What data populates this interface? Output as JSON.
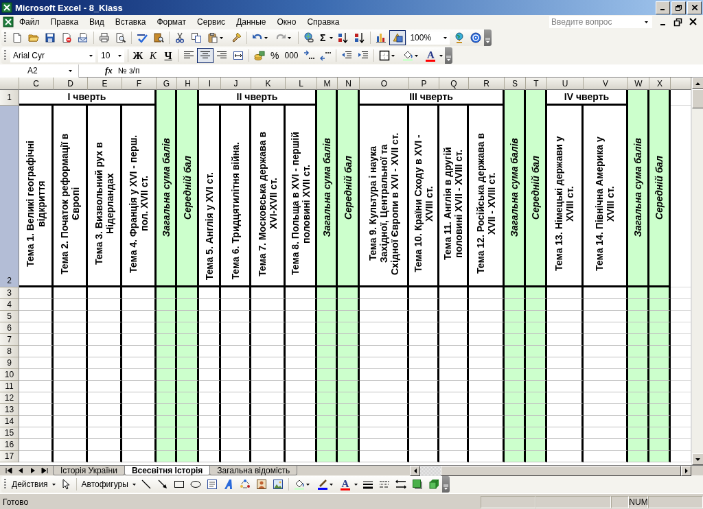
{
  "window": {
    "title": "Microsoft Excel - 8_Klass"
  },
  "menu": [
    "Файл",
    "Правка",
    "Вид",
    "Вставка",
    "Формат",
    "Сервис",
    "Данные",
    "Окно",
    "Справка"
  ],
  "help_box": {
    "placeholder": "Введите вопрос"
  },
  "standard_toolbar": {
    "autosum": "Σ",
    "drawing_toggle": {
      "on": true
    },
    "zoom": "100%"
  },
  "formatting_toolbar": {
    "font": "Arial Cyr",
    "size": "10",
    "style_buttons": [
      {
        "label": "Ж",
        "kind": "bold"
      },
      {
        "label": "К",
        "kind": "italic"
      },
      {
        "label": "Ч",
        "kind": "underline"
      }
    ],
    "alignment": [
      {
        "kind": "left",
        "selected": false
      },
      {
        "kind": "center",
        "selected": true
      },
      {
        "kind": "right",
        "selected": false
      }
    ],
    "percent": "%",
    "thousands": "000",
    "font_color_glyph": "A"
  },
  "formula_bar": {
    "cell": "A2",
    "function_label": "fx",
    "value": "№ з/п"
  },
  "columns": [
    "C",
    "D",
    "E",
    "F",
    "G",
    "H",
    "I",
    "J",
    "K",
    "L",
    "M",
    "N",
    "O",
    "P",
    "Q",
    "R",
    "S",
    "T",
    "U",
    "V",
    "W",
    "X"
  ],
  "rows": [
    {
      "label": "1",
      "selected": false
    },
    {
      "label": "2",
      "selected": true
    },
    {
      "label": "3",
      "selected": false
    },
    {
      "label": "4",
      "selected": false
    },
    {
      "label": "5",
      "selected": false
    },
    {
      "label": "6",
      "selected": false
    },
    {
      "label": "7",
      "selected": false
    },
    {
      "label": "8",
      "selected": false
    },
    {
      "label": "9",
      "selected": false
    },
    {
      "label": "10",
      "selected": false
    },
    {
      "label": "11",
      "selected": false
    },
    {
      "label": "12",
      "selected": false
    },
    {
      "label": "13",
      "selected": false
    },
    {
      "label": "14",
      "selected": false
    },
    {
      "label": "15",
      "selected": false
    },
    {
      "label": "16",
      "selected": false
    },
    {
      "label": "17",
      "selected": false
    }
  ],
  "quarters": [
    {
      "title": "I чверть",
      "topics": [
        "Тема 1. Великі географічні відкриття",
        "Тема 2. Початок реформації в Європі",
        "Тема 3. Визвольний рух в Нідерландах",
        "Тема 4. Франція у XVI - перш. пол. XVII ст."
      ],
      "totals": [
        "Загальна сума балів",
        "Середній бал"
      ]
    },
    {
      "title": "II чверть",
      "topics": [
        "Тема 5. Англія у XVI ст.",
        "Тема 6. Тридцятилітня війна.",
        "Тема 7. Московська держава в XVI-XVII ст.",
        "Тема 8. Польща в XVI - першій половині XVII ст."
      ],
      "totals": [
        "Загальна сума балів",
        "Середній бал"
      ]
    },
    {
      "title": "III чверть",
      "topics": [
        "Тема 9. Культура і наука Західної, Центральної та Східної Європи в XVI - XVII ст.",
        "Тема 10. Країни Сходу в XVI - XVIII ст.",
        "Тема 11. Англія в другій половині XVII - XVIII ст.",
        "Тема 12. Російська держава в XVII - XVIII ст."
      ],
      "totals": [
        "Загальна сума балів",
        "Середній бал"
      ]
    },
    {
      "title": "IV чверть",
      "topics": [
        "Тема 13. Німецькі держави у XVIII ст.",
        "Тема 14. Північна Америка у XVIII ст."
      ],
      "totals": [
        "Загальна сума балів",
        "Середній бал"
      ]
    }
  ],
  "sheet_tabs": [
    {
      "label": "Історія України",
      "selected": false
    },
    {
      "label": "Всесвітня Історія",
      "selected": true
    },
    {
      "label": "Загальна відомість",
      "selected": false
    }
  ],
  "drawing_toolbar": {
    "actions": "Действия",
    "autoshapes": "Автофигуры",
    "font_color_glyph": "A"
  },
  "status_bar": {
    "text": "Готово",
    "indicators": [
      "NUM"
    ]
  }
}
